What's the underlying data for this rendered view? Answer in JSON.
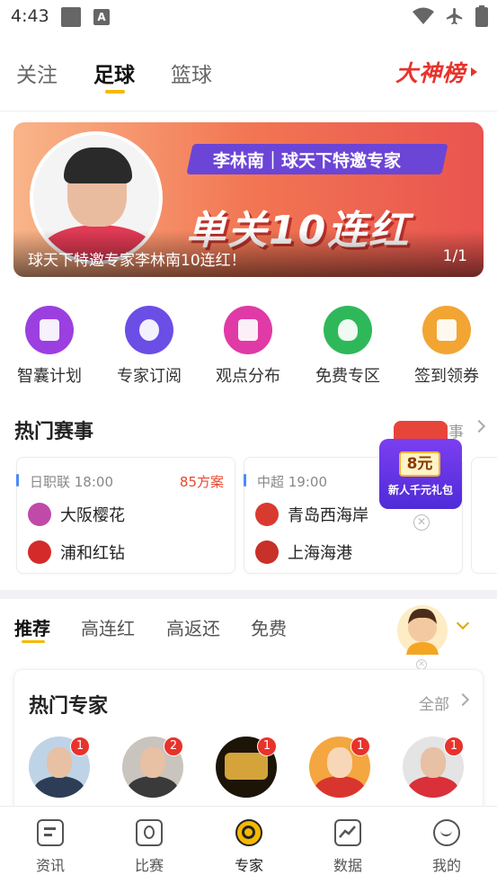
{
  "status_bar": {
    "time": "4:43",
    "a_icon": "A"
  },
  "top_tabs": [
    {
      "label": "关注"
    },
    {
      "label": "足球"
    },
    {
      "label": "篮球"
    }
  ],
  "dashen": {
    "label": "大神榜"
  },
  "banner": {
    "tag": "李林南｜球天下特邀专家",
    "headline": "单关10连红",
    "caption": "球天下特邀专家李林南10连红！",
    "page": "1/1"
  },
  "quick_menu": [
    {
      "label": "智囊计划",
      "color": "#9b3fe0",
      "icon": "calendar-plus-icon"
    },
    {
      "label": "专家订阅",
      "color": "#6b4ee6",
      "icon": "expert-check-icon"
    },
    {
      "label": "观点分布",
      "color": "#e03aa6",
      "icon": "chart-pie-icon"
    },
    {
      "label": "免费专区",
      "color": "#2fb85a",
      "icon": "money-bag-icon"
    },
    {
      "label": "签到领券",
      "color": "#f2a533",
      "icon": "coupon-icon"
    }
  ],
  "hot_matches": {
    "title": "热门赛事",
    "more": "全部赛事",
    "matches": [
      {
        "league_time": "日职联 18:00",
        "plans": "85方案",
        "home": "大阪樱花",
        "away": "浦和红钻",
        "home_color": "#c04aa8",
        "away_color": "#d42a2a"
      },
      {
        "league_time": "中超 19:00",
        "plans": "",
        "home": "青岛西海岸",
        "away": "上海海港",
        "home_color": "#d93a2f",
        "away_color": "#c8302a"
      }
    ]
  },
  "promo": {
    "amount": "8元",
    "text": "新人千元礼包"
  },
  "sub_tabs": [
    {
      "label": "推荐"
    },
    {
      "label": "高连红"
    },
    {
      "label": "高返还"
    },
    {
      "label": "免费"
    }
  ],
  "hot_experts": {
    "title": "热门专家",
    "all": "全部",
    "experts": [
      {
        "badge": "1",
        "bg": "#bfd3e6",
        "body": "#2d3d55"
      },
      {
        "badge": "2",
        "bg": "#c9c4bd",
        "body": "#3a3a3a"
      },
      {
        "badge": "1",
        "bg": "#1d1408",
        "body": "#d4a43a"
      },
      {
        "badge": "1",
        "bg": "#f4a640",
        "body": "#d9352f"
      },
      {
        "badge": "1",
        "bg": "#e4e4e4",
        "body": "#d9303a"
      }
    ]
  },
  "bottom_nav": [
    {
      "label": "资讯",
      "icon": "news-icon"
    },
    {
      "label": "比赛",
      "icon": "match-icon"
    },
    {
      "label": "专家",
      "icon": "expert-icon"
    },
    {
      "label": "数据",
      "icon": "data-chart-icon"
    },
    {
      "label": "我的",
      "icon": "profile-icon"
    }
  ]
}
